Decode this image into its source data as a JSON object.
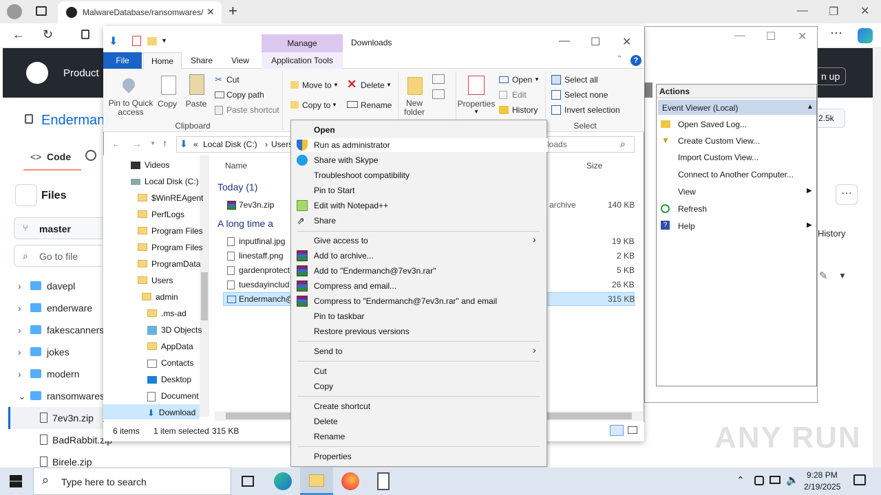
{
  "browser": {
    "tab_title": "MalwareDatabase/ransomwares/",
    "new_tab": "+"
  },
  "github": {
    "header_product": "Product",
    "header_signup": "n up",
    "repo_name": "Enderman",
    "code_tab": "Code",
    "files_title": "Files",
    "branch": "master",
    "goto_file": "Go to file",
    "stars": "2.5k",
    "history": "History",
    "tree": [
      {
        "name": "davepl",
        "type": "folder"
      },
      {
        "name": "enderware",
        "type": "folder"
      },
      {
        "name": "fakescanners",
        "type": "folder"
      },
      {
        "name": "jokes",
        "type": "folder"
      },
      {
        "name": "modern",
        "type": "folder"
      },
      {
        "name": "ransomwares",
        "type": "folder"
      },
      {
        "name": "7ev3n.zip",
        "type": "file"
      },
      {
        "name": "BadRabbit.zip",
        "type": "file"
      },
      {
        "name": "Birele.zip",
        "type": "file"
      }
    ]
  },
  "explorer": {
    "manage": "Manage",
    "title": "Downloads",
    "ribbon_tabs": [
      "File",
      "Home",
      "Share",
      "View",
      "Application Tools"
    ],
    "ribbon": {
      "pin_quick": "Pin to Quick access",
      "copy": "Copy",
      "paste": "Paste",
      "cut": "Cut",
      "copy_path": "Copy path",
      "paste_shortcut": "Paste shortcut",
      "clipboard": "Clipboard",
      "move_to": "Move to",
      "copy_to": "Copy to",
      "delete": "Delete",
      "rename": "Rename",
      "new_folder": "New folder",
      "properties": "Properties",
      "open": "Open",
      "edit": "Edit",
      "history": "History",
      "select_all": "Select all",
      "select_none": "Select none",
      "invert_selection": "Invert selection",
      "select": "Select"
    },
    "address": {
      "prefix": "«",
      "drive": "Local Disk (C:)",
      "sep": "›",
      "users": "Users",
      "search": "loads"
    },
    "nav": [
      "Videos",
      "Local Disk (C:)",
      "$WinREAgent",
      "PerfLogs",
      "Program Files",
      "Program Files",
      "ProgramData",
      "Users",
      "admin",
      ".ms-ad",
      "3D Objects",
      "AppData",
      "Contacts",
      "Desktop",
      "Document",
      "Download"
    ],
    "col_name": "Name",
    "col_size": "Size",
    "group_today": "Today (1)",
    "group_long": "A long time a",
    "files": [
      {
        "name": "7ev3n.zip",
        "type": "archive",
        "size": "140 KB"
      },
      {
        "name": "inputfinal.jpg",
        "type": "",
        "size": "19 KB"
      },
      {
        "name": "linestaff.png",
        "type": "",
        "size": "2 KB"
      },
      {
        "name": "gardenprotect",
        "type": "",
        "size": "5 KB"
      },
      {
        "name": "tuesdayinclud",
        "type": "",
        "size": "26 KB"
      },
      {
        "name": "Endermanch@",
        "type": "",
        "size": "315 KB"
      }
    ],
    "status": {
      "items": "6 items",
      "selected": "1 item selected",
      "size": "315 KB"
    }
  },
  "eventviewer": {
    "actions_title": "Actions",
    "section": "Event Viewer (Local)",
    "actions": [
      "Open Saved Log...",
      "Create Custom View...",
      "Import Custom View...",
      "Connect to Another Computer...",
      "View",
      "Refresh",
      "Help"
    ]
  },
  "context_menu": {
    "items": [
      "Open",
      "Run as administrator",
      "Share with Skype",
      "Troubleshoot compatibility",
      "Pin to Start",
      "Edit with Notepad++",
      "Share",
      "Give access to",
      "Add to archive...",
      "Add to \"Endermanch@7ev3n.rar\"",
      "Compress and email...",
      "Compress to \"Endermanch@7ev3n.rar\" and email",
      "Pin to taskbar",
      "Restore previous versions",
      "Send to",
      "Cut",
      "Copy",
      "Create shortcut",
      "Delete",
      "Rename",
      "Properties"
    ]
  },
  "taskbar": {
    "search_placeholder": "Type here to search",
    "time": "9:28 PM",
    "date": "2/19/2025"
  },
  "watermark": "ANY RUN"
}
